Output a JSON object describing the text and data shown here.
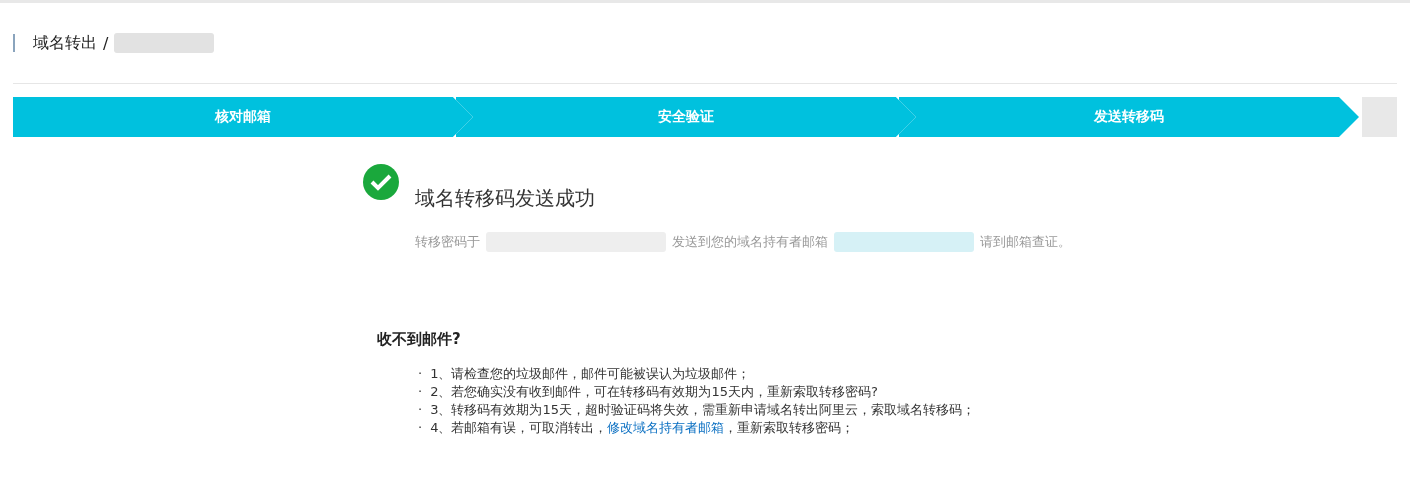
{
  "breadcrumb": {
    "title": "域名转出",
    "separator": "/"
  },
  "steps": [
    {
      "label": "核对邮箱",
      "done": true
    },
    {
      "label": "安全验证",
      "done": true
    },
    {
      "label": "发送转移码",
      "done": true
    }
  ],
  "result": {
    "success": true,
    "title": "域名转移码发送成功",
    "message_parts": [
      "转移密码于",
      "发送到您的域名持有者邮箱",
      "请到邮箱查证。"
    ]
  },
  "help": {
    "heading": "收不到邮件?",
    "items": [
      {
        "bullet": "·",
        "text": "1、请检查您的垃圾邮件，邮件可能被误认为垃圾邮件；"
      },
      {
        "bullet": "·",
        "text": "2、若您确实没有收到邮件，可在转移码有效期为15天内，重新索取转移密码?"
      },
      {
        "bullet": "·",
        "text": "3、转移码有效期为15天，超时验证码将失效，需重新申请域名转出阿里云，索取域名转移码；"
      },
      {
        "bullet": "·",
        "text": "4、若邮箱有误，可取消转出，",
        "link": "修改域名持有者邮箱",
        "after": "，重新索取转移密码；"
      }
    ]
  }
}
